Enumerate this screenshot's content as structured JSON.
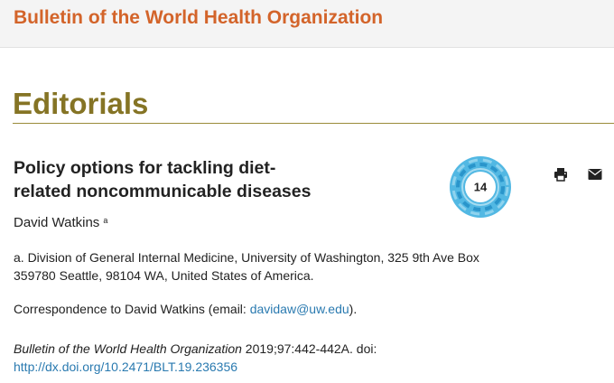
{
  "header": {
    "journal_title": "Bulletin of the World Health Organization"
  },
  "section": {
    "heading": "Editorials"
  },
  "article": {
    "title_line1": "Policy options for tackling diet-",
    "title_line2": "related noncommunicable diseases",
    "author": "David Watkins",
    "author_sup": "a",
    "affiliation": "a. Division of General Internal Medicine, University of Washington, 325 9th Ave Box 359780 Seattle, 98104 WA, United States of America.",
    "correspondence_prefix": "Correspondence to David Watkins (email: ",
    "correspondence_email": "davidaw@uw.edu",
    "correspondence_suffix": ").",
    "citation_journal": "Bulletin of the World Health Organization",
    "citation_details": " 2019;97:442-442A. doi: ",
    "doi_link": "http://dx.doi.org/10.2471/BLT.19.236356"
  },
  "altmetric": {
    "score": "14",
    "colors": [
      "#3fa9d8",
      "#7fcbea",
      "#1f8ac0"
    ]
  },
  "tools": {
    "print_icon": "printer-icon",
    "email_icon": "envelope-icon"
  },
  "colors": {
    "journal_title": "#d3642a",
    "section_heading": "#857425",
    "link": "#2a7ab0"
  }
}
